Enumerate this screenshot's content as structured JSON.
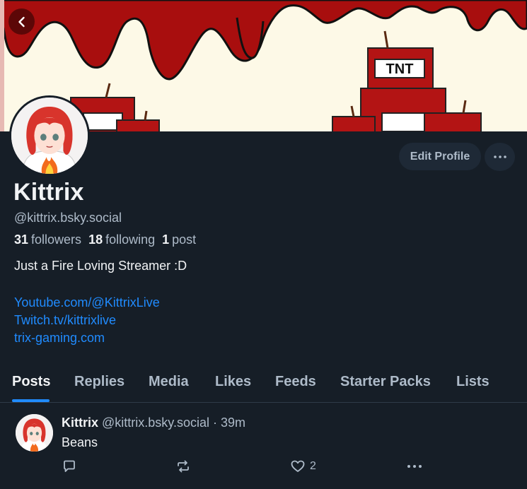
{
  "banner": {
    "sign_text": "TNT",
    "colors": {
      "background": "#fdf9e7",
      "drip": "#a80e0e",
      "tnt_red": "#b31414"
    }
  },
  "profile": {
    "display_name": "Kittrix",
    "handle": "@kittrix.bsky.social",
    "stats": {
      "followers_count": "31",
      "followers_label": "followers",
      "following_count": "18",
      "following_label": "following",
      "posts_count": "1",
      "posts_label": "post"
    },
    "bio": "Just a Fire Loving Streamer :D",
    "links": [
      "Youtube.com/@KittrixLive",
      "Twitch.tv/kittrixlive",
      "trix-gaming.com"
    ]
  },
  "actions": {
    "edit_profile_label": "Edit Profile"
  },
  "tabs": [
    "Posts",
    "Replies",
    "Media",
    "Likes",
    "Feeds",
    "Starter Packs",
    "Lists"
  ],
  "active_tab": "Posts",
  "post": {
    "author": "Kittrix",
    "handle": "@kittrix.bsky.social",
    "separator": "·",
    "time": "39m",
    "text": "Beans",
    "like_count": "2"
  },
  "icons": [
    "back-arrow-icon",
    "more-dots-icon",
    "reply-icon",
    "repost-icon",
    "like-heart-icon",
    "post-more-icon"
  ],
  "colors": {
    "background": "#161e27",
    "accent_link": "#208bfe",
    "muted_text": "#aebbc9"
  }
}
